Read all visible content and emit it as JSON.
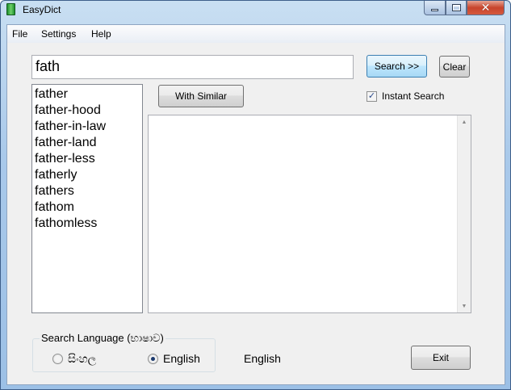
{
  "window": {
    "title": "EasyDict",
    "close_glyph": "✕"
  },
  "menu": {
    "file": "File",
    "settings": "Settings",
    "help": "Help"
  },
  "search": {
    "value": "fath",
    "search_button": "Search >>",
    "clear_button": "Clear",
    "similar_button": "With Similar",
    "instant_search_label": "Instant Search",
    "instant_search_checked": true,
    "check_glyph": "✓"
  },
  "results": {
    "words": [
      "father",
      "father-hood",
      "father-in-law",
      "father-land",
      "father-less",
      "fatherly",
      "fathers",
      "fathom",
      "fathomless"
    ],
    "definition": ""
  },
  "language": {
    "group_label": "Search Language (භාෂාව)",
    "option_sinhala": "සිංහල",
    "option_english": "English",
    "selected": "English",
    "current_label": "English"
  },
  "footer": {
    "exit_button": "Exit"
  },
  "icons": {
    "app": "app-icon",
    "scroll_up": "▲",
    "scroll_down": "▼"
  }
}
